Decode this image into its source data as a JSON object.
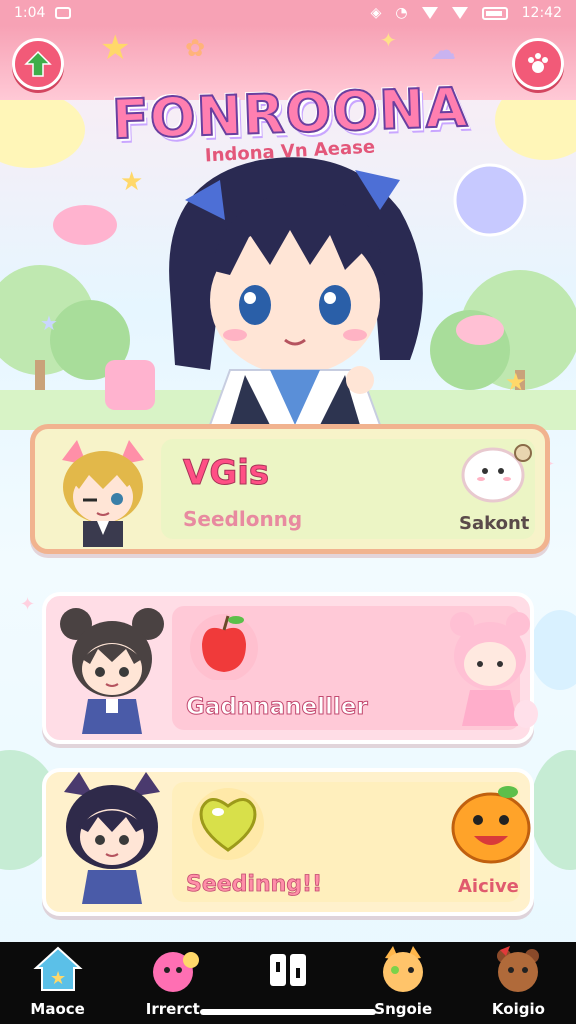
{
  "status_bar": {
    "time": "1:04",
    "clock_right": "12:42"
  },
  "header": {
    "back_icon": "arrow-up-icon",
    "menu_icon": "paw-menu-icon",
    "title": "FONROONA",
    "subtitle": "Indona Vn Aease"
  },
  "cards": [
    {
      "title": "VGis",
      "subtitle": "Seedlonng",
      "action": "Sakont"
    },
    {
      "title": "Gadnnanelller"
    },
    {
      "title": "Seedinng!!",
      "action": "Aicive"
    }
  ],
  "bottom_nav": [
    {
      "label": "Maoce",
      "icon": "house-star-icon"
    },
    {
      "label": "Irrerct",
      "icon": "pink-creature-icon"
    },
    {
      "label": "",
      "icon": "tiles-icon"
    },
    {
      "label": "Sngoie",
      "icon": "cat-face-icon"
    },
    {
      "label": "Koigio",
      "icon": "bear-face-icon"
    }
  ],
  "colors": {
    "accent": "#f25a78",
    "header": "#f7a2b5",
    "title_pink": "#ff7fb0",
    "nav_bg": "#0b0b0b"
  }
}
